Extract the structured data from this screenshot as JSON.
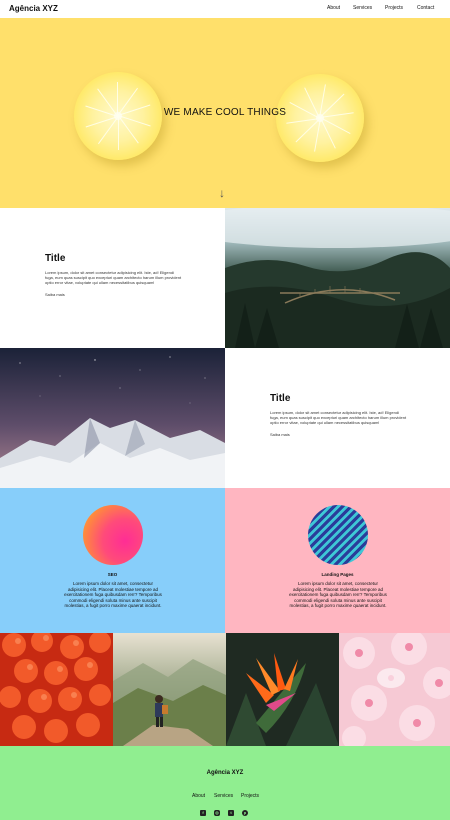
{
  "nav": {
    "brand": "Agência XYZ",
    "links": [
      "About",
      "Services",
      "Projects",
      "Contact"
    ]
  },
  "hero": {
    "title": "WE MAKE COOL THINGS",
    "arrow": "↓"
  },
  "sections": [
    {
      "title": "Title",
      "body": "Lorem ipsum, dolor sit amet consectetur adipisicing elit. Iste, ad! Eligendi fuga, eum quas suscipit quo excepturi quam architecto harum illum provident optio error vitae, voluptate qui ullam necessitatibus quisquam!",
      "link": "Saiba mais"
    },
    {
      "title": "Title",
      "body": "Lorem ipsum, dolor sit amet consectetur adipisicing elit. Iste, ad! Eligendi fuga, eum quas suscipit quo excepturi quam architecto harum illum provident optio error vitae, voluptate qui ullam necessitatibus quisquam!",
      "link": "Saiba mais"
    }
  ],
  "features": [
    {
      "title": "SEO",
      "body": "Lorem ipsum dolor sit amet, consectetur adipisicing elit. Placeat molestiae tempore ad exercitationem fuga quibusdam rerr? Temporibus commodi eligendi soluta minus ante suscipit molestias, a fugit porro maxime quaerat incidunt."
    },
    {
      "title": "Landing Pages",
      "body": "Lorem ipsum dolor sit amet, consectetur adipisicing elit. Placeat molestiae tempore ad exercitationem fuga quibusdam rerr? Temporibus commodi eligendi soluta minus ante suscipit molestias, a fugit porro maxime quaerat incidunt."
    }
  ],
  "footer": {
    "brand": "Agência XYZ",
    "links": [
      "About",
      "Services",
      "Projects"
    ],
    "social": [
      "facebook-icon",
      "instagram-icon",
      "twitter-icon",
      "pinterest-icon"
    ]
  },
  "colors": {
    "hero_bg": "#ffe06b",
    "seo_bg": "#87cefa",
    "landing_bg": "#ffb6c1",
    "footer_bg": "#90ee90"
  }
}
